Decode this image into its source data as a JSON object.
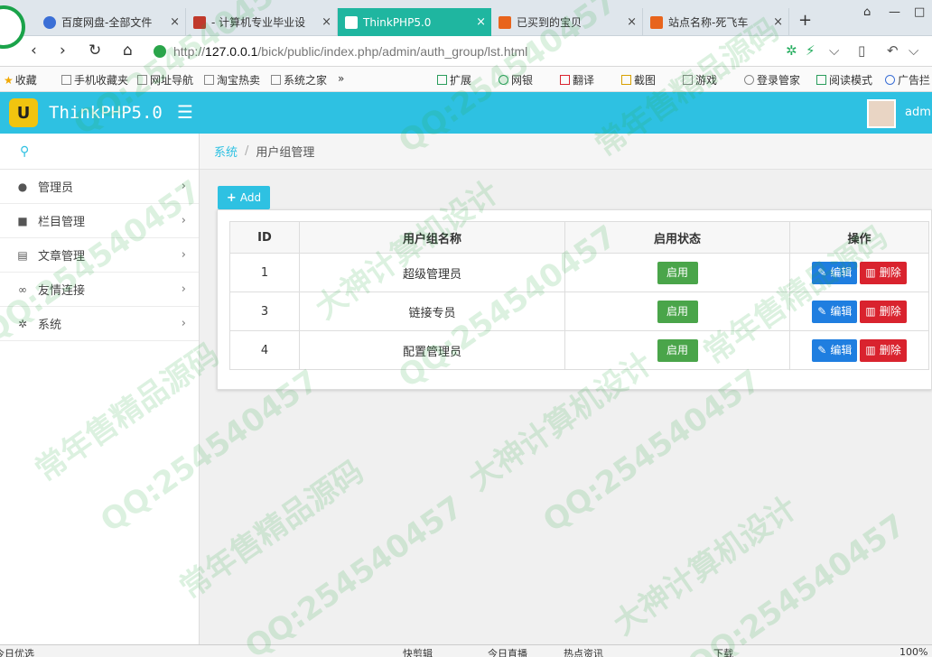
{
  "browser": {
    "tabs": [
      {
        "label": "百度网盘-全部文件",
        "active": false,
        "color": "#3b6fd6"
      },
      {
        "label": "- 计算机专业毕业设",
        "active": false,
        "color": "#c0392b"
      },
      {
        "label": "ThinkPHP5.0",
        "active": true,
        "color": "#1fb6a0"
      },
      {
        "label": "已买到的宝贝",
        "active": false,
        "color": "#e8641c"
      },
      {
        "label": "站点名称-死飞车",
        "active": false,
        "color": "#e8641c"
      }
    ],
    "tab_close": "×",
    "new_tab": "+",
    "url_host": "127.0.0.1",
    "url_path": "/bick/public/index.php/admin/auth_group/lst.html",
    "url_scheme": "http://"
  },
  "bookmarks": {
    "left": [
      "收藏",
      "手机收藏夹",
      "网址导航",
      "淘宝热卖",
      "系统之家"
    ],
    "more": "»",
    "right": [
      "扩展",
      "网银",
      "翻译",
      "截图",
      "游戏",
      "登录管家",
      "阅读模式",
      "广告拦"
    ]
  },
  "app": {
    "logo_text": "U",
    "title": "ThinkPHP5.0",
    "user": "admi"
  },
  "sidebar": {
    "items": [
      {
        "label": "管理员",
        "icon": "user-icon"
      },
      {
        "label": "栏目管理",
        "icon": "folder-icon"
      },
      {
        "label": "文章管理",
        "icon": "file-icon"
      },
      {
        "label": "友情连接",
        "icon": "link-icon"
      },
      {
        "label": "系统",
        "icon": "gear-icon"
      }
    ]
  },
  "breadcrumb": {
    "parent": "系统",
    "separator": "/",
    "current": "用户组管理"
  },
  "toolbar": {
    "add_label": "Add"
  },
  "table": {
    "headers": [
      "ID",
      "用户组名称",
      "启用状态",
      "操作"
    ],
    "rows": [
      {
        "id": "1",
        "name": "超级管理员",
        "status": "启用"
      },
      {
        "id": "3",
        "name": "链接专员",
        "status": "启用"
      },
      {
        "id": "4",
        "name": "配置管理员",
        "status": "启用"
      }
    ],
    "edit_label": "编辑",
    "delete_label": "删除"
  },
  "statusbar": {
    "left": "今日优选",
    "items": [
      "快剪辑",
      "今日直播",
      "热点资讯",
      "下载",
      "100%"
    ]
  },
  "watermark": {
    "lines": [
      "QQ:254540457",
      "常年售精品源码",
      "大神计算机设计"
    ]
  },
  "colors": {
    "header": "#2ec1e2",
    "active_tab": "#1fb6a0",
    "status_green": "#4aa54a",
    "edit_blue": "#1f7ee0",
    "delete_red": "#d9232e"
  }
}
